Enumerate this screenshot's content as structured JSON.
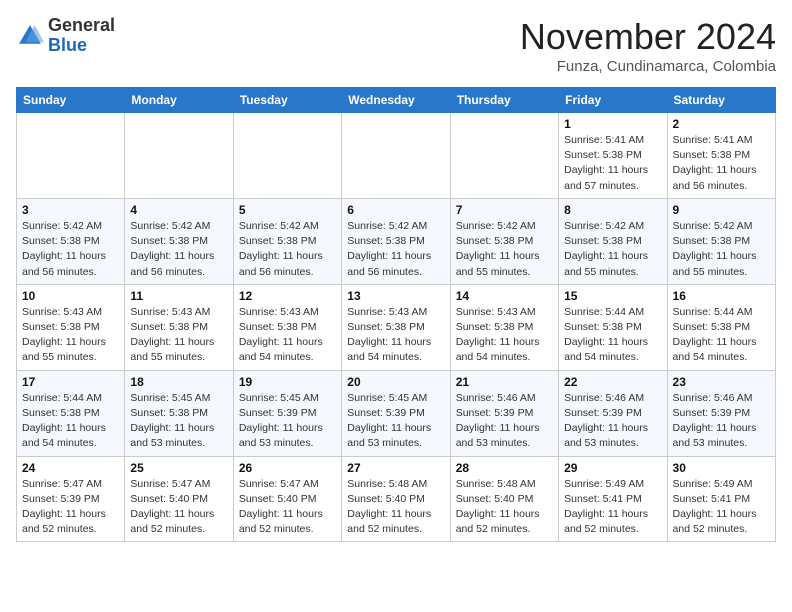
{
  "header": {
    "logo_general": "General",
    "logo_blue": "Blue",
    "month_title": "November 2024",
    "location": "Funza, Cundinamarca, Colombia"
  },
  "weekdays": [
    "Sunday",
    "Monday",
    "Tuesday",
    "Wednesday",
    "Thursday",
    "Friday",
    "Saturday"
  ],
  "weeks": [
    [
      {
        "day": "",
        "info": ""
      },
      {
        "day": "",
        "info": ""
      },
      {
        "day": "",
        "info": ""
      },
      {
        "day": "",
        "info": ""
      },
      {
        "day": "",
        "info": ""
      },
      {
        "day": "1",
        "info": "Sunrise: 5:41 AM\nSunset: 5:38 PM\nDaylight: 11 hours and 57 minutes."
      },
      {
        "day": "2",
        "info": "Sunrise: 5:41 AM\nSunset: 5:38 PM\nDaylight: 11 hours and 56 minutes."
      }
    ],
    [
      {
        "day": "3",
        "info": "Sunrise: 5:42 AM\nSunset: 5:38 PM\nDaylight: 11 hours and 56 minutes."
      },
      {
        "day": "4",
        "info": "Sunrise: 5:42 AM\nSunset: 5:38 PM\nDaylight: 11 hours and 56 minutes."
      },
      {
        "day": "5",
        "info": "Sunrise: 5:42 AM\nSunset: 5:38 PM\nDaylight: 11 hours and 56 minutes."
      },
      {
        "day": "6",
        "info": "Sunrise: 5:42 AM\nSunset: 5:38 PM\nDaylight: 11 hours and 56 minutes."
      },
      {
        "day": "7",
        "info": "Sunrise: 5:42 AM\nSunset: 5:38 PM\nDaylight: 11 hours and 55 minutes."
      },
      {
        "day": "8",
        "info": "Sunrise: 5:42 AM\nSunset: 5:38 PM\nDaylight: 11 hours and 55 minutes."
      },
      {
        "day": "9",
        "info": "Sunrise: 5:42 AM\nSunset: 5:38 PM\nDaylight: 11 hours and 55 minutes."
      }
    ],
    [
      {
        "day": "10",
        "info": "Sunrise: 5:43 AM\nSunset: 5:38 PM\nDaylight: 11 hours and 55 minutes."
      },
      {
        "day": "11",
        "info": "Sunrise: 5:43 AM\nSunset: 5:38 PM\nDaylight: 11 hours and 55 minutes."
      },
      {
        "day": "12",
        "info": "Sunrise: 5:43 AM\nSunset: 5:38 PM\nDaylight: 11 hours and 54 minutes."
      },
      {
        "day": "13",
        "info": "Sunrise: 5:43 AM\nSunset: 5:38 PM\nDaylight: 11 hours and 54 minutes."
      },
      {
        "day": "14",
        "info": "Sunrise: 5:43 AM\nSunset: 5:38 PM\nDaylight: 11 hours and 54 minutes."
      },
      {
        "day": "15",
        "info": "Sunrise: 5:44 AM\nSunset: 5:38 PM\nDaylight: 11 hours and 54 minutes."
      },
      {
        "day": "16",
        "info": "Sunrise: 5:44 AM\nSunset: 5:38 PM\nDaylight: 11 hours and 54 minutes."
      }
    ],
    [
      {
        "day": "17",
        "info": "Sunrise: 5:44 AM\nSunset: 5:38 PM\nDaylight: 11 hours and 54 minutes."
      },
      {
        "day": "18",
        "info": "Sunrise: 5:45 AM\nSunset: 5:38 PM\nDaylight: 11 hours and 53 minutes."
      },
      {
        "day": "19",
        "info": "Sunrise: 5:45 AM\nSunset: 5:39 PM\nDaylight: 11 hours and 53 minutes."
      },
      {
        "day": "20",
        "info": "Sunrise: 5:45 AM\nSunset: 5:39 PM\nDaylight: 11 hours and 53 minutes."
      },
      {
        "day": "21",
        "info": "Sunrise: 5:46 AM\nSunset: 5:39 PM\nDaylight: 11 hours and 53 minutes."
      },
      {
        "day": "22",
        "info": "Sunrise: 5:46 AM\nSunset: 5:39 PM\nDaylight: 11 hours and 53 minutes."
      },
      {
        "day": "23",
        "info": "Sunrise: 5:46 AM\nSunset: 5:39 PM\nDaylight: 11 hours and 53 minutes."
      }
    ],
    [
      {
        "day": "24",
        "info": "Sunrise: 5:47 AM\nSunset: 5:39 PM\nDaylight: 11 hours and 52 minutes."
      },
      {
        "day": "25",
        "info": "Sunrise: 5:47 AM\nSunset: 5:40 PM\nDaylight: 11 hours and 52 minutes."
      },
      {
        "day": "26",
        "info": "Sunrise: 5:47 AM\nSunset: 5:40 PM\nDaylight: 11 hours and 52 minutes."
      },
      {
        "day": "27",
        "info": "Sunrise: 5:48 AM\nSunset: 5:40 PM\nDaylight: 11 hours and 52 minutes."
      },
      {
        "day": "28",
        "info": "Sunrise: 5:48 AM\nSunset: 5:40 PM\nDaylight: 11 hours and 52 minutes."
      },
      {
        "day": "29",
        "info": "Sunrise: 5:49 AM\nSunset: 5:41 PM\nDaylight: 11 hours and 52 minutes."
      },
      {
        "day": "30",
        "info": "Sunrise: 5:49 AM\nSunset: 5:41 PM\nDaylight: 11 hours and 52 minutes."
      }
    ]
  ]
}
